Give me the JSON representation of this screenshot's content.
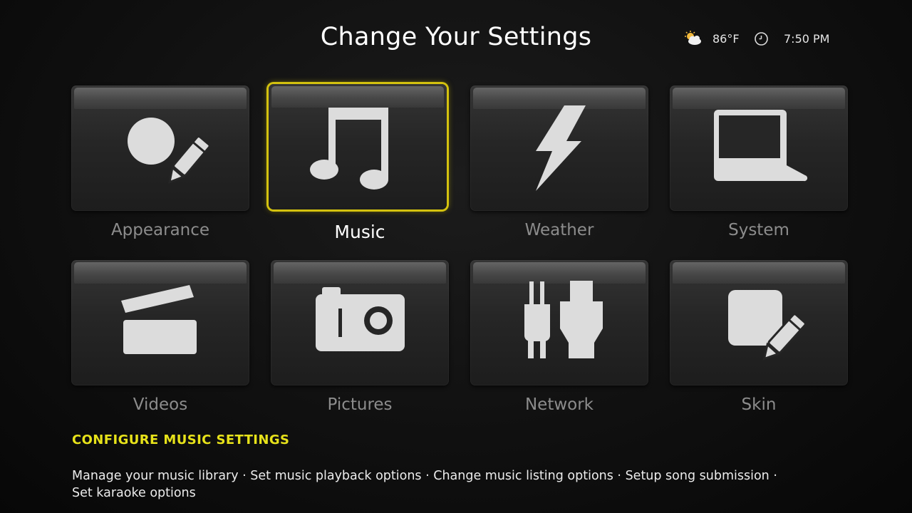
{
  "header": {
    "title": "Change Your Settings"
  },
  "status": {
    "weather_icon": "partly-cloudy-icon",
    "temperature": "86°F",
    "clock_icon": "clock-icon",
    "time": "7:50 PM"
  },
  "menu": {
    "items": [
      {
        "label": "Appearance",
        "icon": "paintbrush-icon",
        "selected": false
      },
      {
        "label": "Music",
        "icon": "music-note-icon",
        "selected": true
      },
      {
        "label": "Weather",
        "icon": "lightning-icon",
        "selected": false
      },
      {
        "label": "System",
        "icon": "computer-icon",
        "selected": false
      },
      {
        "label": "Videos",
        "icon": "clapperboard-icon",
        "selected": false
      },
      {
        "label": "Pictures",
        "icon": "camera-icon",
        "selected": false
      },
      {
        "label": "Network",
        "icon": "plug-icon",
        "selected": false
      },
      {
        "label": "Skin",
        "icon": "skin-edit-icon",
        "selected": false
      }
    ]
  },
  "info": {
    "heading": "CONFIGURE MUSIC SETTINGS",
    "description_line1": "Manage your music library · Set music playback options · Change music listing options · Setup song submission ·",
    "description_line2": "Set karaoke options"
  },
  "colors": {
    "accent": "#d4c20f",
    "heading": "#e7e21a",
    "inactive_label": "#8c8c8c",
    "icon_fill": "#dcdcdc"
  }
}
